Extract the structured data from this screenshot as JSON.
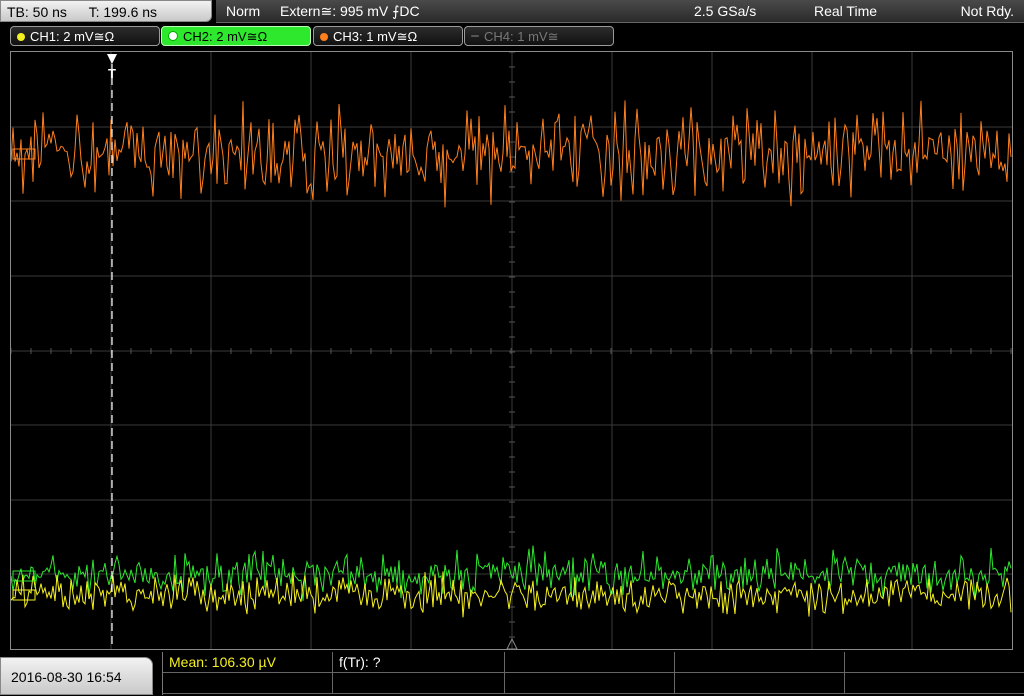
{
  "timebase": {
    "tb_label": "TB: 50 ns",
    "trigger_time_label": "T: 199.6 ns"
  },
  "status_bar": {
    "mode": "Norm",
    "trigger_source": "Extern≅: 995 mV ⨍DC",
    "sample_rate": "2.5 GSa/s",
    "acq_mode": "Real Time",
    "state": "Not Rdy."
  },
  "channels": [
    {
      "label": "CH1: 2 mV≅Ω",
      "color": "#f5f020",
      "state": "on"
    },
    {
      "label": "CH2: 2 mV≅Ω",
      "color": "#2ee82e",
      "state": "active"
    },
    {
      "label": "CH3: 1 mV≅Ω",
      "color": "#ff7f1e",
      "state": "on"
    },
    {
      "label": "CH4: 1 mV≅",
      "color": "#777777",
      "state": "off"
    }
  ],
  "display": {
    "grid_color": "#3a3a3a",
    "trigger_marker": "T"
  },
  "footer": {
    "datetime": "2016-08-30 16:54",
    "measurements": [
      {
        "label": "Mean: 106.30 µV",
        "color": "#f5f020"
      },
      {
        "label": "f(Tr): ?",
        "color": "#ffffff"
      }
    ]
  }
}
